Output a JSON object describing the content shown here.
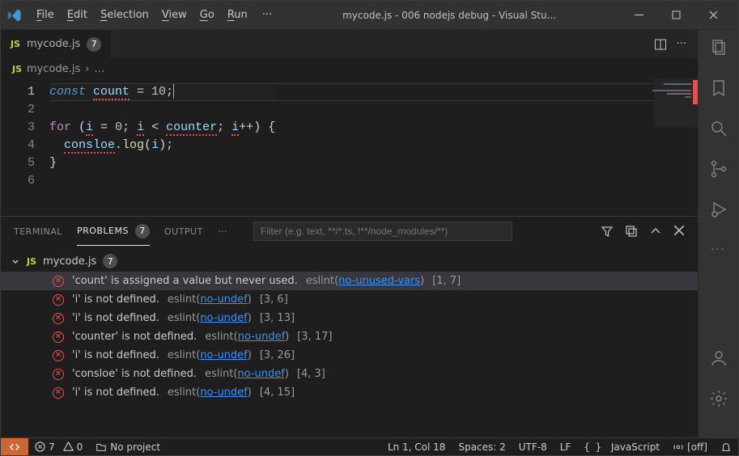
{
  "window": {
    "title": "mycode.js - 006 nodejs debug - Visual Stu..."
  },
  "menu": {
    "items": [
      {
        "label": "File",
        "accel": "F"
      },
      {
        "label": "Edit",
        "accel": "E"
      },
      {
        "label": "Selection",
        "accel": "S"
      },
      {
        "label": "View",
        "accel": "V"
      },
      {
        "label": "Go",
        "accel": "G"
      },
      {
        "label": "Run",
        "accel": "R"
      }
    ]
  },
  "editor": {
    "tab": {
      "js_badge": "JS",
      "filename": "mycode.js",
      "problem_badge": "7"
    },
    "breadcrumb": {
      "filename": "mycode.js"
    },
    "code": {
      "lines": [
        {
          "n": 1,
          "tokens": [
            [
              "kw2",
              "const "
            ],
            [
              "var err",
              "count"
            ],
            [
              "op",
              " = "
            ],
            [
              "num",
              "10"
            ],
            [
              "punct",
              ";"
            ]
          ]
        },
        {
          "n": 2,
          "tokens": []
        },
        {
          "n": 3,
          "tokens": [
            [
              "kw",
              "for "
            ],
            [
              "punct",
              "("
            ],
            [
              "var err",
              "i"
            ],
            [
              "op",
              " = "
            ],
            [
              "num",
              "0"
            ],
            [
              "punct",
              "; "
            ],
            [
              "var err",
              "i"
            ],
            [
              "op",
              " < "
            ],
            [
              "var err",
              "counter"
            ],
            [
              "punct",
              "; "
            ],
            [
              "var err",
              "i"
            ],
            [
              "op",
              "++"
            ],
            [
              "punct",
              ")"
            ],
            [
              "op",
              " {"
            ]
          ]
        },
        {
          "n": 4,
          "tokens": [
            [
              "plain",
              "  "
            ],
            [
              "var err",
              "consloe"
            ],
            [
              "punct",
              "."
            ],
            [
              "func",
              "log"
            ],
            [
              "punct",
              "("
            ],
            [
              "var",
              "i"
            ],
            [
              "punct",
              ")"
            ],
            [
              "punct",
              ";"
            ]
          ]
        },
        {
          "n": 5,
          "tokens": [
            [
              "op",
              "}"
            ]
          ]
        },
        {
          "n": 6,
          "tokens": []
        }
      ],
      "active_line": 1
    }
  },
  "panel": {
    "tabs": {
      "terminal": "TERMINAL",
      "problems": "PROBLEMS",
      "problems_badge": "7",
      "output": "OUTPUT"
    },
    "filter_placeholder": "Filter (e.g. text, **/*.ts, !**/node_modules/**)",
    "problems": {
      "file": {
        "icon": "JS",
        "name": "mycode.js",
        "count": "7"
      },
      "items": [
        {
          "msg": "'count' is assigned a value but never used.",
          "source": "eslint",
          "rule": "no-unused-vars",
          "loc": "[1, 7]",
          "selected": true
        },
        {
          "msg": "'i' is not defined.",
          "source": "eslint",
          "rule": "no-undef",
          "loc": "[3, 6]"
        },
        {
          "msg": "'i' is not defined.",
          "source": "eslint",
          "rule": "no-undef",
          "loc": "[3, 13]"
        },
        {
          "msg": "'counter' is not defined.",
          "source": "eslint",
          "rule": "no-undef",
          "loc": "[3, 17]"
        },
        {
          "msg": "'i' is not defined.",
          "source": "eslint",
          "rule": "no-undef",
          "loc": "[3, 26]"
        },
        {
          "msg": "'consloe' is not defined.",
          "source": "eslint",
          "rule": "no-undef",
          "loc": "[4, 3]"
        },
        {
          "msg": "'i' is not defined.",
          "source": "eslint",
          "rule": "no-undef",
          "loc": "[4, 15]"
        }
      ]
    }
  },
  "statusbar": {
    "errors": "7",
    "warnings": "0",
    "project": "No project",
    "position": "Ln 1, Col 18",
    "spaces": "Spaces: 2",
    "encoding": "UTF-8",
    "eol": "LF",
    "language": "JavaScript",
    "golive": "[off]"
  }
}
